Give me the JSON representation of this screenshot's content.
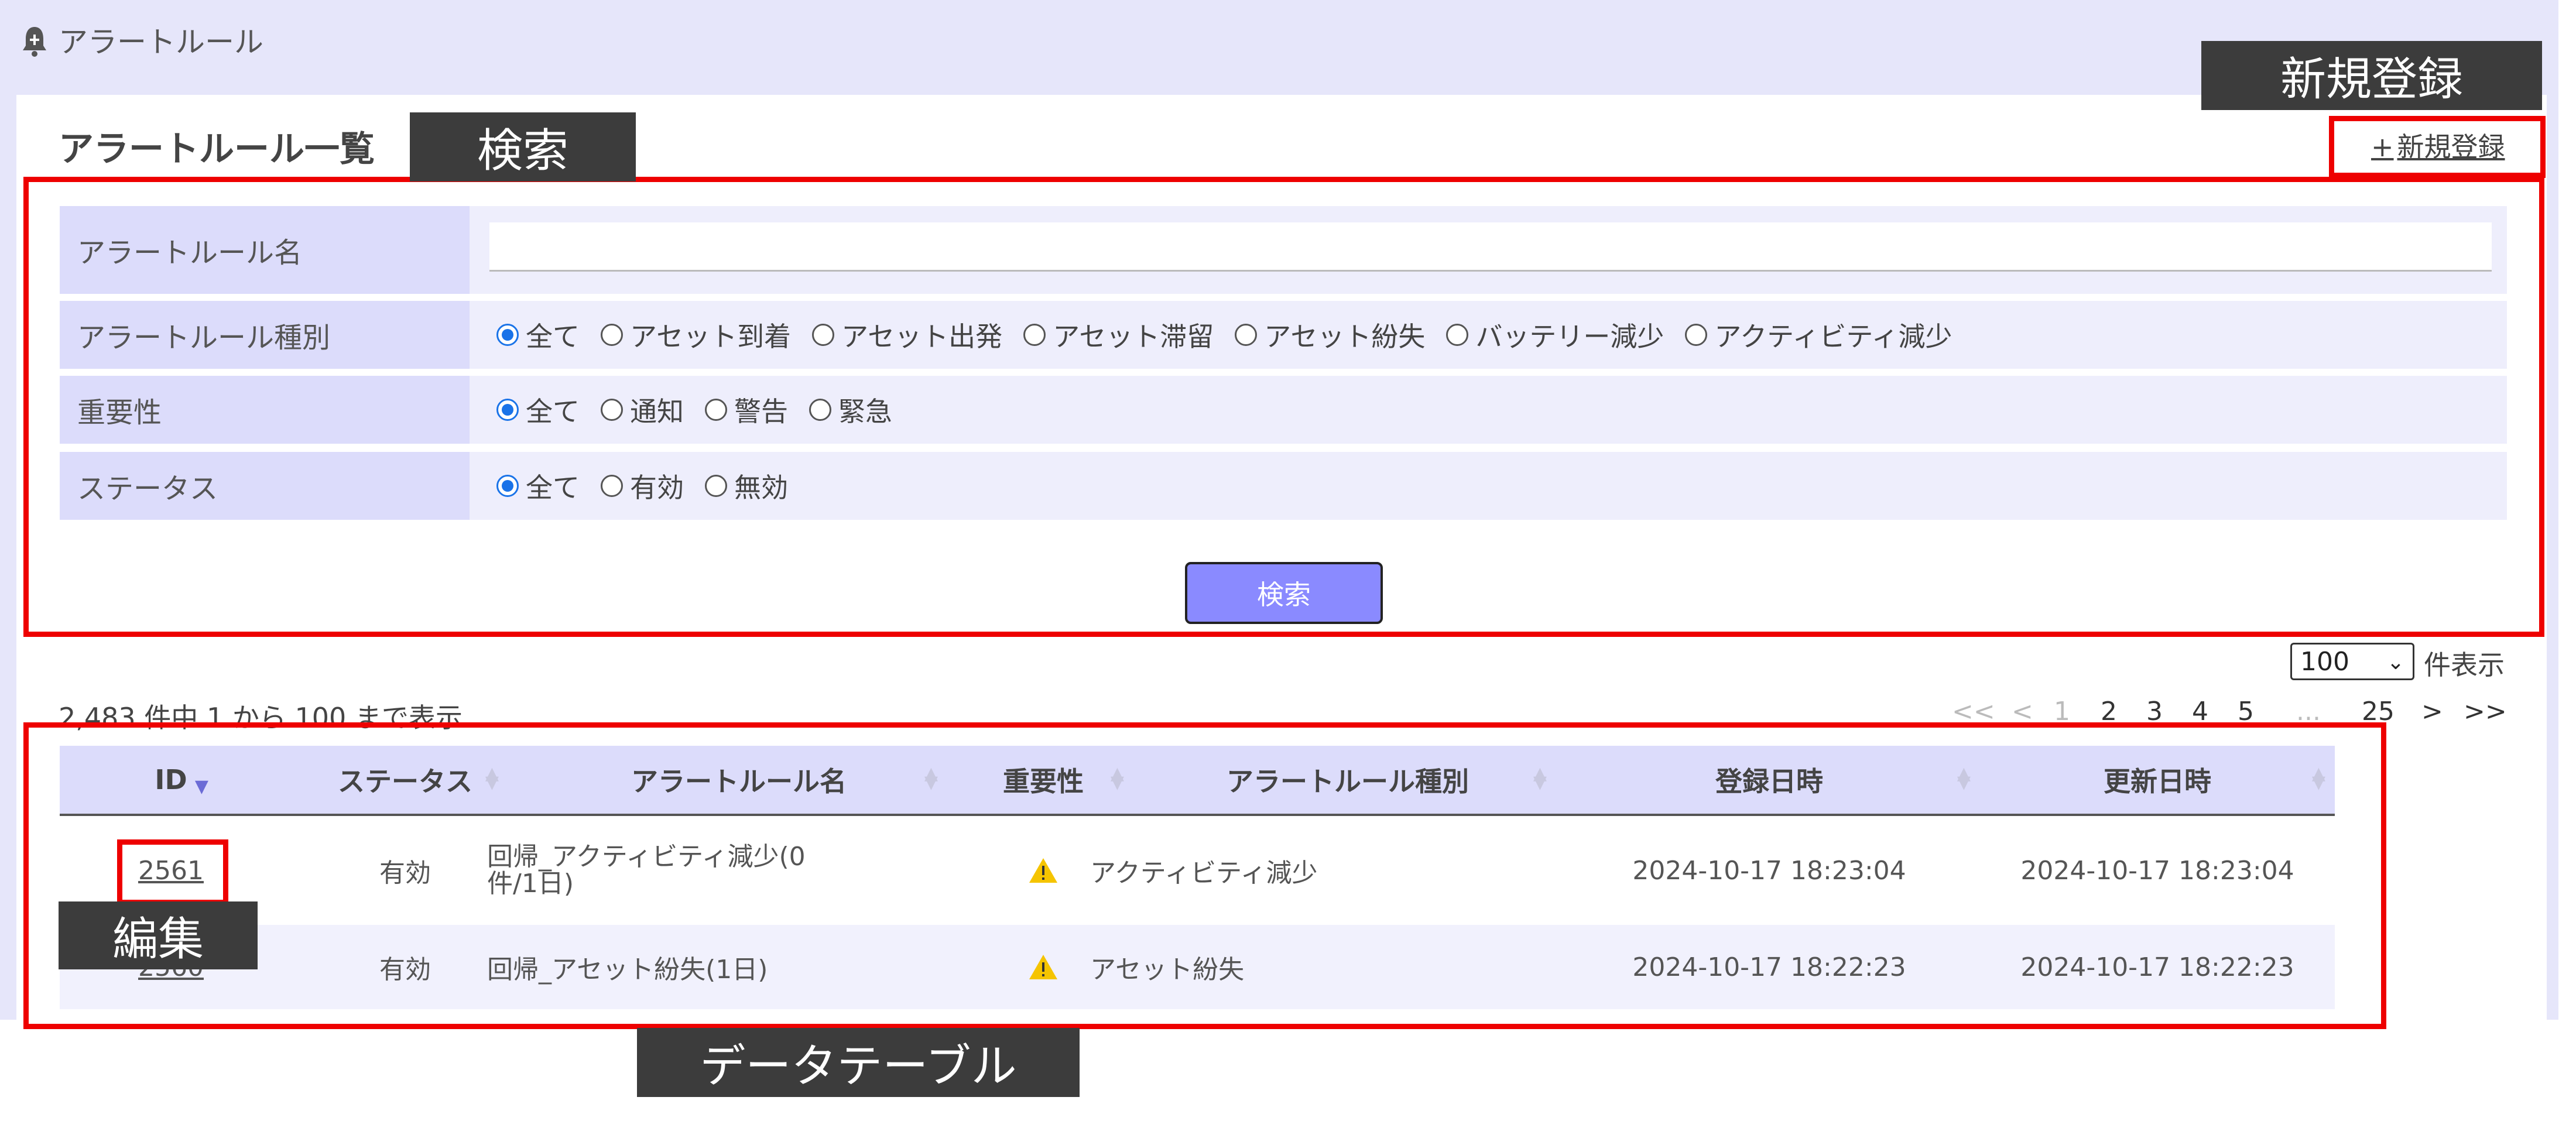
{
  "breadcrumb": {
    "label": "アラートルール"
  },
  "page_title": "アラートルール一覧",
  "new_link": {
    "plus": "+",
    "label": "新規登録"
  },
  "search_form": {
    "name_label": "アラートルール名",
    "name_value": "",
    "type_label": "アラートルール種別",
    "type_options": [
      "全て",
      "アセット到着",
      "アセット出発",
      "アセット滞留",
      "アセット紛失",
      "バッテリー減少",
      "アクティビティ減少"
    ],
    "type_selected": "全て",
    "severity_label": "重要性",
    "severity_options": [
      "全て",
      "通知",
      "警告",
      "緊急"
    ],
    "severity_selected": "全て",
    "status_label": "ステータス",
    "status_options": [
      "全て",
      "有効",
      "無効"
    ],
    "status_selected": "全て",
    "search_button": "検索"
  },
  "per_page": {
    "value": "100",
    "label": "件表示"
  },
  "summary": "2,483 件中 1 から 100 まで表示",
  "pagination": {
    "first": "<<",
    "prev": "<",
    "pages": [
      "1",
      "2",
      "3",
      "4",
      "5"
    ],
    "ellipsis": "...",
    "last_page": "25",
    "next": ">",
    "last": ">>"
  },
  "table": {
    "columns": [
      "ID",
      "ステータス",
      "アラートルール名",
      "重要性",
      "アラートルール種別",
      "登録日時",
      "更新日時"
    ],
    "rows": [
      {
        "id": "2561",
        "status": "有効",
        "name_line1": "回帰_アクティビティ減少(0",
        "name_line2": "件/1日)",
        "severity_icon": "warning-icon",
        "type": "アクティビティ減少",
        "created": "2024-10-17 18:23:04",
        "updated": "2024-10-17 18:23:04"
      },
      {
        "id": "2560",
        "status": "有効",
        "name_line1": "回帰_アセット紛失(1日)",
        "name_line2": "",
        "severity_icon": "warning-icon",
        "type": "アセット紛失",
        "created": "2024-10-17 18:22:23",
        "updated": "2024-10-17 18:22:23"
      }
    ]
  },
  "annotations": {
    "new_register": "新規登録",
    "search": "検索",
    "edit": "編集",
    "data_table": "データテーブル"
  },
  "colors": {
    "background": "#e6e6fa",
    "label_cell": "#dcdcfb",
    "button": "#8a8aff",
    "annotation_box": "#ee0000",
    "annotation_tag": "#3c3c3c",
    "warning": "#f5c400"
  }
}
